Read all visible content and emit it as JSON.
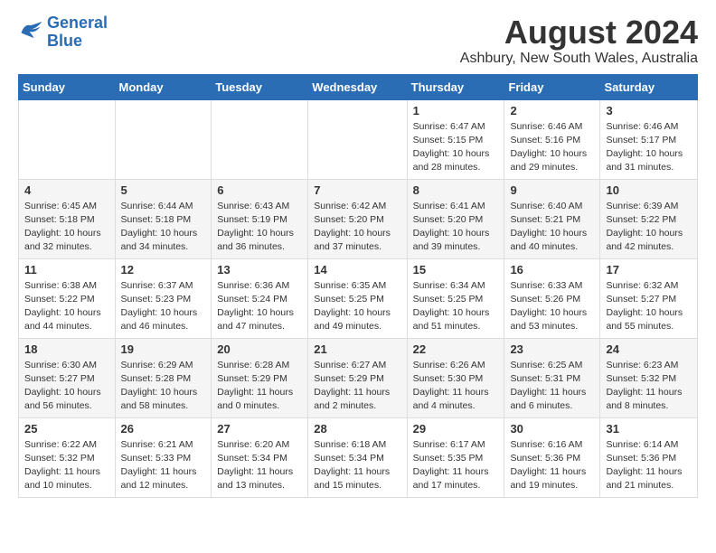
{
  "logo": {
    "line1": "General",
    "line2": "Blue"
  },
  "title": "August 2024",
  "subtitle": "Ashbury, New South Wales, Australia",
  "weekdays": [
    "Sunday",
    "Monday",
    "Tuesday",
    "Wednesday",
    "Thursday",
    "Friday",
    "Saturday"
  ],
  "weeks": [
    [
      {
        "day": "",
        "info": ""
      },
      {
        "day": "",
        "info": ""
      },
      {
        "day": "",
        "info": ""
      },
      {
        "day": "",
        "info": ""
      },
      {
        "day": "1",
        "info": "Sunrise: 6:47 AM\nSunset: 5:15 PM\nDaylight: 10 hours\nand 28 minutes."
      },
      {
        "day": "2",
        "info": "Sunrise: 6:46 AM\nSunset: 5:16 PM\nDaylight: 10 hours\nand 29 minutes."
      },
      {
        "day": "3",
        "info": "Sunrise: 6:46 AM\nSunset: 5:17 PM\nDaylight: 10 hours\nand 31 minutes."
      }
    ],
    [
      {
        "day": "4",
        "info": "Sunrise: 6:45 AM\nSunset: 5:18 PM\nDaylight: 10 hours\nand 32 minutes."
      },
      {
        "day": "5",
        "info": "Sunrise: 6:44 AM\nSunset: 5:18 PM\nDaylight: 10 hours\nand 34 minutes."
      },
      {
        "day": "6",
        "info": "Sunrise: 6:43 AM\nSunset: 5:19 PM\nDaylight: 10 hours\nand 36 minutes."
      },
      {
        "day": "7",
        "info": "Sunrise: 6:42 AM\nSunset: 5:20 PM\nDaylight: 10 hours\nand 37 minutes."
      },
      {
        "day": "8",
        "info": "Sunrise: 6:41 AM\nSunset: 5:20 PM\nDaylight: 10 hours\nand 39 minutes."
      },
      {
        "day": "9",
        "info": "Sunrise: 6:40 AM\nSunset: 5:21 PM\nDaylight: 10 hours\nand 40 minutes."
      },
      {
        "day": "10",
        "info": "Sunrise: 6:39 AM\nSunset: 5:22 PM\nDaylight: 10 hours\nand 42 minutes."
      }
    ],
    [
      {
        "day": "11",
        "info": "Sunrise: 6:38 AM\nSunset: 5:22 PM\nDaylight: 10 hours\nand 44 minutes."
      },
      {
        "day": "12",
        "info": "Sunrise: 6:37 AM\nSunset: 5:23 PM\nDaylight: 10 hours\nand 46 minutes."
      },
      {
        "day": "13",
        "info": "Sunrise: 6:36 AM\nSunset: 5:24 PM\nDaylight: 10 hours\nand 47 minutes."
      },
      {
        "day": "14",
        "info": "Sunrise: 6:35 AM\nSunset: 5:25 PM\nDaylight: 10 hours\nand 49 minutes."
      },
      {
        "day": "15",
        "info": "Sunrise: 6:34 AM\nSunset: 5:25 PM\nDaylight: 10 hours\nand 51 minutes."
      },
      {
        "day": "16",
        "info": "Sunrise: 6:33 AM\nSunset: 5:26 PM\nDaylight: 10 hours\nand 53 minutes."
      },
      {
        "day": "17",
        "info": "Sunrise: 6:32 AM\nSunset: 5:27 PM\nDaylight: 10 hours\nand 55 minutes."
      }
    ],
    [
      {
        "day": "18",
        "info": "Sunrise: 6:30 AM\nSunset: 5:27 PM\nDaylight: 10 hours\nand 56 minutes."
      },
      {
        "day": "19",
        "info": "Sunrise: 6:29 AM\nSunset: 5:28 PM\nDaylight: 10 hours\nand 58 minutes."
      },
      {
        "day": "20",
        "info": "Sunrise: 6:28 AM\nSunset: 5:29 PM\nDaylight: 11 hours\nand 0 minutes."
      },
      {
        "day": "21",
        "info": "Sunrise: 6:27 AM\nSunset: 5:29 PM\nDaylight: 11 hours\nand 2 minutes."
      },
      {
        "day": "22",
        "info": "Sunrise: 6:26 AM\nSunset: 5:30 PM\nDaylight: 11 hours\nand 4 minutes."
      },
      {
        "day": "23",
        "info": "Sunrise: 6:25 AM\nSunset: 5:31 PM\nDaylight: 11 hours\nand 6 minutes."
      },
      {
        "day": "24",
        "info": "Sunrise: 6:23 AM\nSunset: 5:32 PM\nDaylight: 11 hours\nand 8 minutes."
      }
    ],
    [
      {
        "day": "25",
        "info": "Sunrise: 6:22 AM\nSunset: 5:32 PM\nDaylight: 11 hours\nand 10 minutes."
      },
      {
        "day": "26",
        "info": "Sunrise: 6:21 AM\nSunset: 5:33 PM\nDaylight: 11 hours\nand 12 minutes."
      },
      {
        "day": "27",
        "info": "Sunrise: 6:20 AM\nSunset: 5:34 PM\nDaylight: 11 hours\nand 13 minutes."
      },
      {
        "day": "28",
        "info": "Sunrise: 6:18 AM\nSunset: 5:34 PM\nDaylight: 11 hours\nand 15 minutes."
      },
      {
        "day": "29",
        "info": "Sunrise: 6:17 AM\nSunset: 5:35 PM\nDaylight: 11 hours\nand 17 minutes."
      },
      {
        "day": "30",
        "info": "Sunrise: 6:16 AM\nSunset: 5:36 PM\nDaylight: 11 hours\nand 19 minutes."
      },
      {
        "day": "31",
        "info": "Sunrise: 6:14 AM\nSunset: 5:36 PM\nDaylight: 11 hours\nand 21 minutes."
      }
    ]
  ]
}
